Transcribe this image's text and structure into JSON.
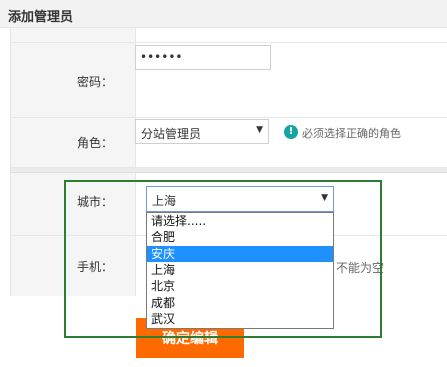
{
  "window": {
    "title": "添加管理员"
  },
  "form": {
    "password": {
      "label": "密码：",
      "value": "••••••"
    },
    "role": {
      "label": "角色：",
      "selected": "分站管理员",
      "hint": "必须选择正确的角色",
      "hint_icon": "!"
    },
    "city": {
      "label": "城市：",
      "selected": "上海",
      "options": [
        "请选择.....",
        "合肥",
        "安庆",
        "上海",
        "北京",
        "成都",
        "武汉"
      ],
      "highlighted": "安庆"
    },
    "phone": {
      "label": "手机：",
      "tail_text": "不能为空"
    },
    "submit_label": "确定编辑"
  },
  "colors": {
    "accent_orange": "#ff6a00",
    "highlight_blue": "#1e90ff",
    "annotation_green": "#2e7d32",
    "hint_teal": "#16a3a3"
  }
}
